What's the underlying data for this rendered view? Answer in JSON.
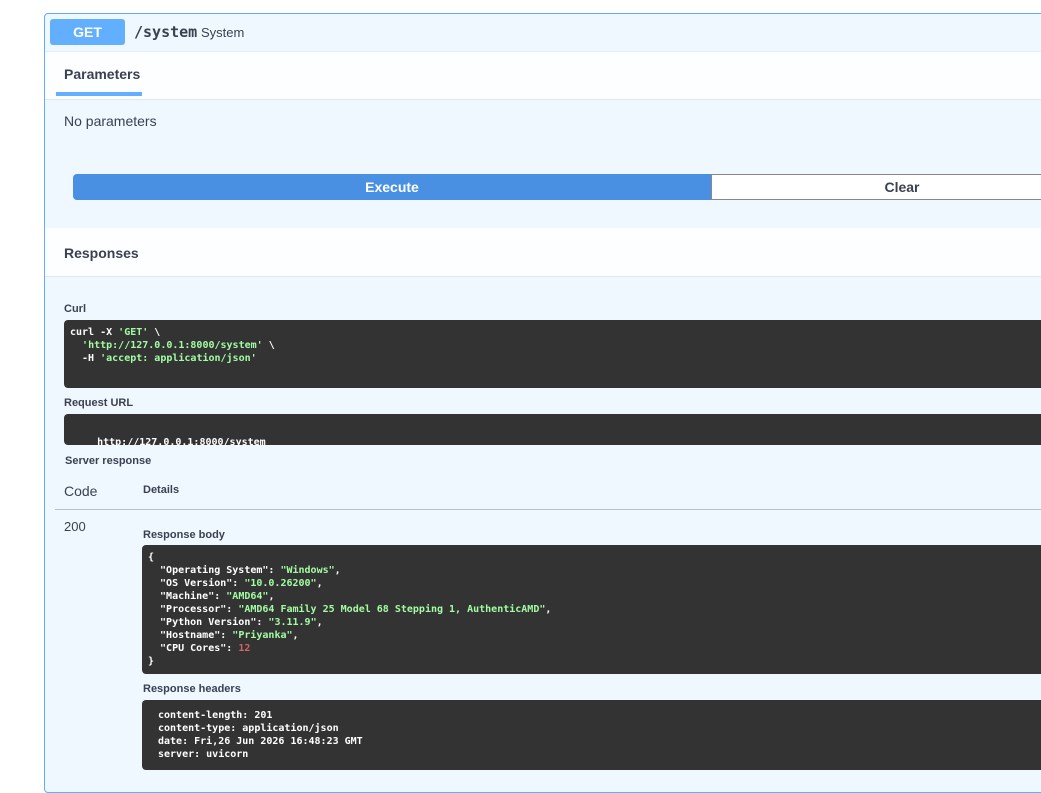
{
  "operation": {
    "method": "GET",
    "path": "/system",
    "summary": "System"
  },
  "parameters": {
    "tab_label": "Parameters",
    "empty_text": "No parameters"
  },
  "actions": {
    "execute_label": "Execute",
    "clear_label": "Clear"
  },
  "responses": {
    "title": "Responses",
    "curl_label": "Curl",
    "curl_lines": [
      "curl -X 'GET' \\",
      "  'http://127.0.0.1:8000/system' \\",
      "  -H 'accept: application/json'"
    ],
    "request_url_label": "Request URL",
    "request_url": "http://127.0.0.1:8000/system",
    "server_response_label": "Server response",
    "code_header": "Code",
    "details_header": "Details",
    "status_code": "200",
    "response_body_label": "Response body",
    "response_body": [
      {
        "key": "Operating System",
        "value": "Windows",
        "type": "string"
      },
      {
        "key": "OS Version",
        "value": "10.0.26200",
        "type": "string"
      },
      {
        "key": "Machine",
        "value": "AMD64",
        "type": "string"
      },
      {
        "key": "Processor",
        "value": "AMD64 Family 25 Model 68 Stepping 1, AuthenticAMD",
        "type": "string"
      },
      {
        "key": "Python Version",
        "value": "3.11.9",
        "type": "string"
      },
      {
        "key": "Hostname",
        "value": "Priyanka",
        "type": "string"
      },
      {
        "key": "CPU Cores",
        "value": "12",
        "type": "number"
      }
    ],
    "response_headers_label": "Response headers",
    "response_headers": [
      "content-length: 201",
      "content-type: application/json",
      "date: Fri,26 Jun 2026 16:48:23 GMT",
      "server: uvicorn"
    ]
  },
  "colors": {
    "accent": "#61affe",
    "execute": "#4990e2",
    "code_bg": "#333333",
    "string": "#a2fca2",
    "number": "#d36363"
  }
}
